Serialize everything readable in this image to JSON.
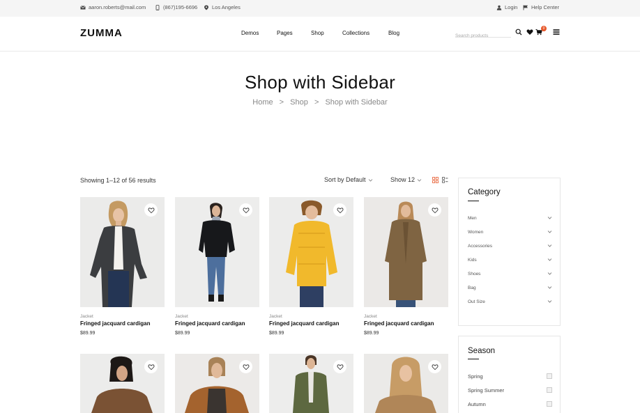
{
  "topbar": {
    "email": "aaron.roberts@mail.com",
    "phone": "(867)195-6696",
    "location": "Los Angeles",
    "login": "Login",
    "help": "Help Center"
  },
  "header": {
    "logo": "ZUMMA",
    "nav": [
      "Demos",
      "Pages",
      "Shop",
      "Collections",
      "Blog"
    ],
    "search_placeholder": "Search products",
    "cart_count": "0"
  },
  "page": {
    "title": "Shop with Sidebar",
    "breadcrumb": [
      "Home",
      ">",
      "Shop",
      ">",
      "Shop with Sidebar"
    ]
  },
  "toolbar": {
    "result_count": "Showing 1–12 of 56 results",
    "sort_label": "Sort by Default",
    "show_label": "Show 12"
  },
  "products": [
    {
      "category": "Jacket",
      "name": "Fringed jacquard cardigan",
      "price": "$89.99"
    },
    {
      "category": "Jacket",
      "name": "Fringed jacquard cardigan",
      "price": "$89.99"
    },
    {
      "category": "Jacket",
      "name": "Fringed jacquard cardigan",
      "price": "$89.99"
    },
    {
      "category": "Jacket",
      "name": "Fringed jacquard cardigan",
      "price": "$89.99"
    }
  ],
  "sidebar": {
    "category": {
      "title": "Category",
      "items": [
        "Men",
        "Women",
        "Accessories",
        "Kids",
        "Shoes",
        "Bag",
        "Out Size"
      ]
    },
    "season": {
      "title": "Season",
      "items": [
        "Spring",
        "Spring Summer",
        "Autumn"
      ]
    }
  },
  "colors": {
    "accent": "#e7582b",
    "background": "#ffffff",
    "topbar": "#f5f5f5"
  }
}
